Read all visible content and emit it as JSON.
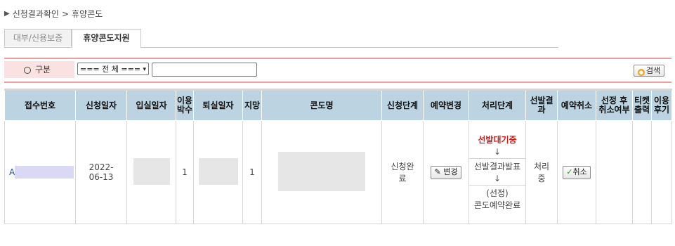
{
  "breadcrumb": {
    "marker": "▶",
    "parent": "신청결과확인",
    "sep": ">",
    "current": "휴양콘도"
  },
  "tabs": [
    {
      "label": "대부/신용보증"
    },
    {
      "label": "휴양콘도지원"
    }
  ],
  "search": {
    "label": "구분",
    "select_value": "=== 전 체 ===",
    "keyword_value": "",
    "button_label": "검색"
  },
  "table": {
    "headers": [
      "접수번호",
      "신청일자",
      "입실일자",
      "이용박수",
      "퇴실일자",
      "지망",
      "콘도명",
      "신청단계",
      "예약변경",
      "처리단계",
      "선발결과",
      "예약취소",
      "선정 후 취소여부",
      "티켓출력",
      "이용후기"
    ],
    "row": {
      "receipt_prefix": "A",
      "apply_date": "2022-06-13",
      "nights": "1",
      "choice": "1",
      "apply_stage": "신청완료",
      "change_button": "변경",
      "process_steps": [
        "선발대기중",
        "↓",
        "선발결과발표",
        "↓",
        "(선정)",
        "콘도예약완료"
      ],
      "selection_result": "처리중",
      "cancel_button": "취소"
    }
  }
}
